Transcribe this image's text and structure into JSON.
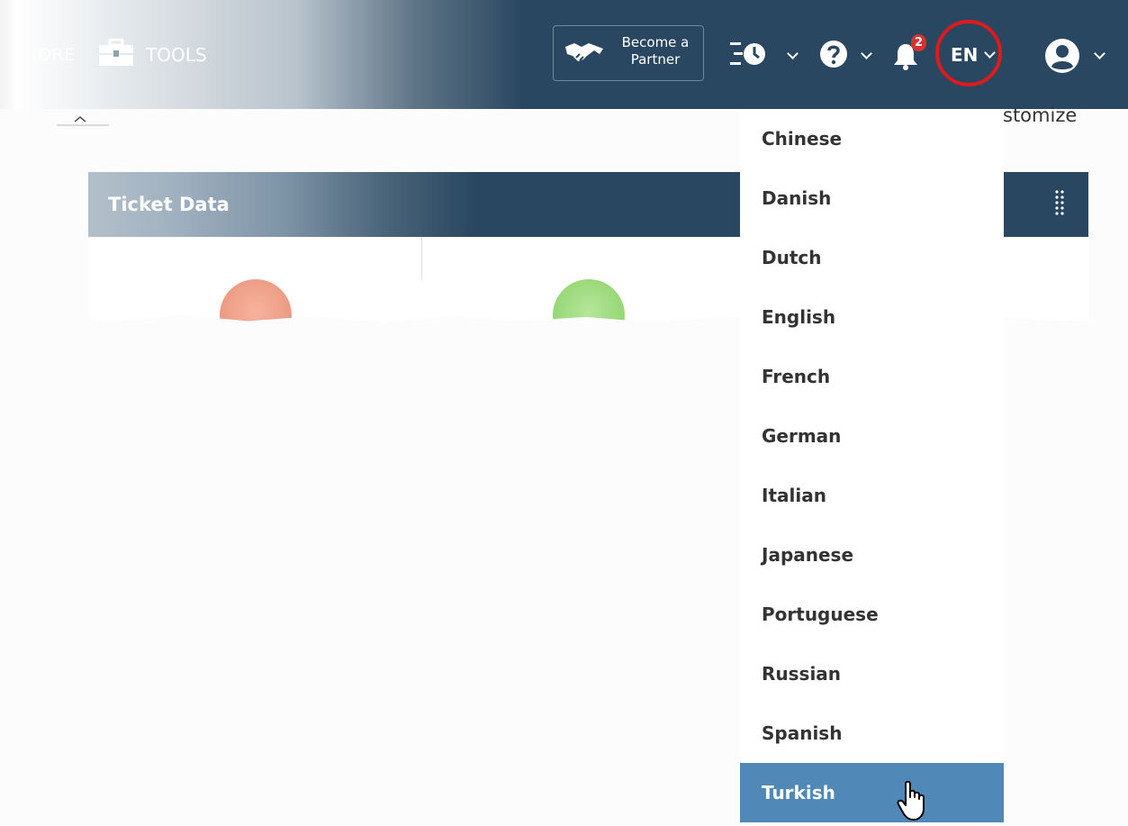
{
  "header": {
    "more_label": "ORE",
    "tools_label": "TOOLS",
    "partner_button_label": "Become a\nPartner",
    "notification_count": "2",
    "language_code": "EN",
    "accent_color": "#2a4761",
    "icons": [
      "toolbox-icon",
      "handshake-icon",
      "history-icon",
      "help-icon",
      "bell-icon",
      "user-avatar-icon"
    ]
  },
  "content": {
    "customize_label": "stomize",
    "panel_title": "Ticket Data",
    "circle_colors": [
      "#ee9d85",
      "#9ed97c"
    ]
  },
  "language_menu": {
    "items": [
      "Chinese",
      "Danish",
      "Dutch",
      "English",
      "French",
      "German",
      "Italian",
      "Japanese",
      "Portuguese",
      "Russian",
      "Spanish",
      "Turkish"
    ],
    "hovered": "Turkish",
    "hover_color": "#5088b7"
  }
}
